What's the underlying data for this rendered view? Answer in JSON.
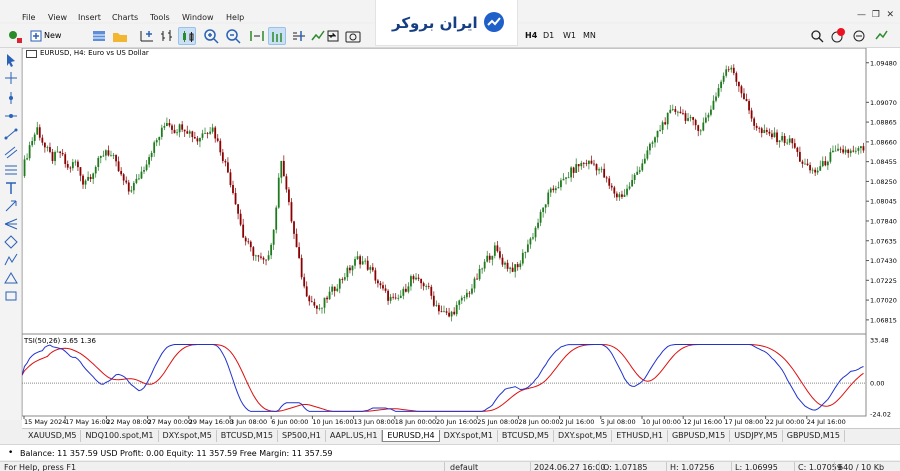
{
  "menu": [
    "File",
    "View",
    "Insert",
    "Charts",
    "Tools",
    "Window",
    "Help"
  ],
  "logo": {
    "text": "ایران بروکر"
  },
  "toolbar": {
    "new_order": "New Order",
    "timeframes": [
      "H4",
      "D1",
      "W1",
      "MN"
    ]
  },
  "chart": {
    "title": "EURUSD, H4:  Euro vs US Dollar",
    "price_axis": [
      "1.09480",
      "1.09070",
      "1.08865",
      "1.08660",
      "1.08455",
      "1.08250",
      "1.08045",
      "1.07840",
      "1.07635",
      "1.07430",
      "1.07225",
      "1.07020",
      "1.06815"
    ],
    "indicator_title": "TSI(50,26) 3.65 1.36",
    "indicator_axis": [
      "33.48",
      "0.00",
      "-24.02"
    ],
    "time_axis": [
      "15 May 2024",
      "17 May 16:00",
      "22 May 08:00",
      "27 May 00:00",
      "29 May 16:00",
      "3 Jun 08:00",
      "6 Jun 00:00",
      "10 Jun 16:00",
      "13 Jun 08:00",
      "18 Jun 00:00",
      "20 Jun 16:00",
      "25 Jun 08:00",
      "28 Jun 00:00",
      "2 Jul 16:00",
      "5 Jul 08:00",
      "10 Jul 00:00",
      "12 Jul 16:00",
      "17 Jul 08:00",
      "22 Jul 00:00",
      "24 Jul 16:00"
    ]
  },
  "chart_data": {
    "type": "candlestick",
    "title": "EURUSD, H4:  Euro vs US Dollar",
    "ylim": [
      1.0671,
      1.0955
    ],
    "close_path": [
      [
        0,
        1.0835
      ],
      [
        3,
        1.0862
      ],
      [
        6,
        1.088
      ],
      [
        9,
        1.086
      ],
      [
        12,
        1.0849
      ],
      [
        15,
        1.0855
      ],
      [
        18,
        1.0838
      ],
      [
        21,
        1.0845
      ],
      [
        24,
        1.0825
      ],
      [
        27,
        1.0832
      ],
      [
        30,
        1.0845
      ],
      [
        33,
        1.0858
      ],
      [
        36,
        1.0848
      ],
      [
        39,
        1.083
      ],
      [
        42,
        1.0815
      ],
      [
        45,
        1.0825
      ],
      [
        48,
        1.084
      ],
      [
        51,
        1.0858
      ],
      [
        54,
        1.0872
      ],
      [
        57,
        1.0888
      ],
      [
        60,
        1.0878
      ],
      [
        63,
        1.0883
      ],
      [
        66,
        1.0876
      ],
      [
        69,
        1.0868
      ],
      [
        72,
        1.0878
      ],
      [
        75,
        1.088
      ],
      [
        78,
        1.0858
      ],
      [
        81,
        1.0835
      ],
      [
        84,
        1.0805
      ],
      [
        87,
        1.0768
      ],
      [
        90,
        1.0754
      ],
      [
        93,
        1.0745
      ],
      [
        96,
        1.074
      ],
      [
        99,
        1.0775
      ],
      [
        102,
        1.085
      ],
      [
        105,
        1.08
      ],
      [
        108,
        1.0755
      ],
      [
        111,
        1.0715
      ],
      [
        114,
        1.07
      ],
      [
        117,
        1.069
      ],
      [
        120,
        1.0705
      ],
      [
        123,
        1.0715
      ],
      [
        126,
        1.0725
      ],
      [
        129,
        1.0735
      ],
      [
        132,
        1.0745
      ],
      [
        135,
        1.074
      ],
      [
        138,
        1.073
      ],
      [
        141,
        1.0715
      ],
      [
        144,
        1.0705
      ],
      [
        147,
        1.07
      ],
      [
        150,
        1.071
      ],
      [
        153,
        1.0725
      ],
      [
        156,
        1.072
      ],
      [
        159,
        1.0718
      ],
      [
        162,
        1.07
      ],
      [
        165,
        1.069
      ],
      [
        168,
        1.0685
      ],
      [
        171,
        1.0695
      ],
      [
        174,
        1.0705
      ],
      [
        177,
        1.0715
      ],
      [
        180,
        1.073
      ],
      [
        183,
        1.0745
      ],
      [
        186,
        1.0755
      ],
      [
        189,
        1.0742
      ],
      [
        192,
        1.0735
      ],
      [
        195,
        1.0735
      ],
      [
        198,
        1.0755
      ],
      [
        201,
        1.077
      ],
      [
        204,
        1.079
      ],
      [
        207,
        1.081
      ],
      [
        210,
        1.082
      ],
      [
        213,
        1.0825
      ],
      [
        216,
        1.0835
      ],
      [
        219,
        1.0842
      ],
      [
        222,
        1.0845
      ],
      [
        225,
        1.0843
      ],
      [
        228,
        1.0835
      ],
      [
        231,
        1.082
      ],
      [
        234,
        1.081
      ],
      [
        237,
        1.0812
      ],
      [
        240,
        1.0825
      ],
      [
        243,
        1.084
      ],
      [
        246,
        1.0855
      ],
      [
        249,
        1.087
      ],
      [
        252,
        1.0885
      ],
      [
        255,
        1.0895
      ],
      [
        258,
        1.09
      ],
      [
        261,
        1.0892
      ],
      [
        264,
        1.0885
      ],
      [
        267,
        1.088
      ],
      [
        270,
        1.0895
      ],
      [
        273,
        1.0915
      ],
      [
        276,
        1.0935
      ],
      [
        279,
        1.0945
      ],
      [
        282,
        1.0925
      ],
      [
        285,
        1.0905
      ],
      [
        288,
        1.0885
      ],
      [
        291,
        1.0875
      ],
      [
        294,
        1.0874
      ],
      [
        297,
        1.087
      ],
      [
        300,
        1.0868
      ],
      [
        303,
        1.0865
      ],
      [
        306,
        1.0848
      ],
      [
        309,
        1.0838
      ],
      [
        312,
        1.0835
      ],
      [
        315,
        1.0842
      ],
      [
        318,
        1.0852
      ],
      [
        321,
        1.0855
      ],
      [
        324,
        1.0857
      ],
      [
        327,
        1.0854
      ],
      [
        330,
        1.0858
      ]
    ],
    "indicator": {
      "name": "TSI(50,26)",
      "values": [
        3.65,
        1.36
      ],
      "ylim": [
        -24.02,
        33.48
      ]
    },
    "colors": {
      "up": "#1f7a1f",
      "down": "#8b0000",
      "tsi": "#2233cc",
      "signal": "#dd1111"
    }
  },
  "tabs": [
    "XAUUSD,M5",
    "NDQ100.spot,M1",
    "DXY.spot,M5",
    "BTCUSD,M15",
    "SP500,H1",
    "AAPL.US,H1",
    "EURUSD,H4",
    "DXY.spot,M1",
    "BTCUSD,M5",
    "DXY.spot,M5",
    "ETHUSD,H1",
    "GBPUSD,M15",
    "USDJPY,M5",
    "GBPUSD,M15"
  ],
  "active_tab": "EURUSD,H4",
  "account": {
    "text": "Balance: 11 357.59 USD  Profit: 0.00  Equity: 11 357.59  Free Margin: 11 357.59"
  },
  "status": {
    "help": "For Help, press F1",
    "profile": "default",
    "datetime": "2024.06.27 16:00",
    "open": "O: 1.07185",
    "high": "H: 1.07256",
    "low": "L: 1.06995",
    "close": "C: 1.07059",
    "traffic": "640 / 10 Kb"
  }
}
